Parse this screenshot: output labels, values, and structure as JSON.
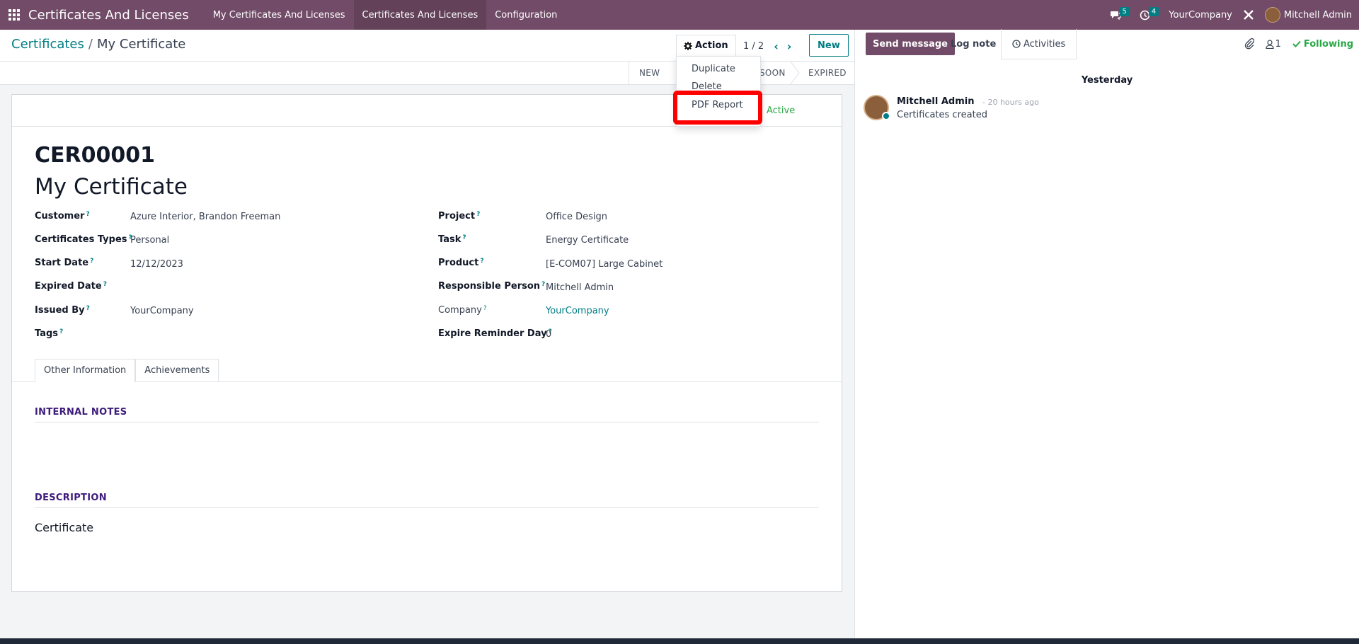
{
  "topbar": {
    "brand": "Certificates And Licenses",
    "menu": [
      "My Certificates And Licenses",
      "Certificates And Licenses",
      "Configuration"
    ],
    "messages_count": "5",
    "activities_count": "4",
    "company": "YourCompany",
    "user": "Mitchell Admin"
  },
  "breadcrumb": {
    "parent": "Certificates",
    "separator": "/",
    "current": "My Certificate"
  },
  "toolbar": {
    "action_label": "Action",
    "pager": "1 / 2",
    "new_label": "New"
  },
  "action_menu": {
    "items": [
      "Duplicate",
      "Delete",
      "PDF Report"
    ]
  },
  "statusbar": {
    "stages": [
      "NEW",
      "EXPIRED SOON",
      "EXPIRED"
    ],
    "visible_partial": "SOON"
  },
  "form": {
    "status_ribbon": "Active",
    "reference": "CER00001",
    "name": "My Certificate",
    "left_fields": [
      {
        "label": "Customer",
        "value": "Azure Interior, Brandon Freeman"
      },
      {
        "label": "Certificates Types",
        "value": "Personal"
      },
      {
        "label": "Start Date",
        "value": "12/12/2023"
      },
      {
        "label": "Expired Date",
        "value": ""
      },
      {
        "label": "Issued By",
        "value": "YourCompany"
      },
      {
        "label": "Tags",
        "value": ""
      }
    ],
    "right_fields": [
      {
        "label": "Project",
        "value": "Office Design"
      },
      {
        "label": "Task",
        "value": "Energy Certificate"
      },
      {
        "label": "Product",
        "value": "[E-COM07] Large Cabinet"
      },
      {
        "label": "Responsible Person",
        "value": "Mitchell Admin"
      },
      {
        "label": "Company",
        "value": "YourCompany"
      },
      {
        "label": "Expire Reminder Day",
        "value": "0"
      }
    ],
    "tabs": [
      "Other Information",
      "Achievements"
    ],
    "internal_notes_title": "INTERNAL NOTES",
    "description_title": "DESCRIPTION",
    "description_text": "Certificate"
  },
  "chatter": {
    "send_message": "Send message",
    "log_note": "Log note",
    "activities": "Activities",
    "followers_count": "1",
    "following": "Following",
    "day_separator": "Yesterday",
    "message": {
      "author": "Mitchell Admin",
      "time": "- 20 hours ago",
      "body": "Certificates created"
    }
  },
  "colors": {
    "brand": "#714B67",
    "accent": "#017e84",
    "success": "#28a745",
    "highlight": "#ff0000"
  }
}
